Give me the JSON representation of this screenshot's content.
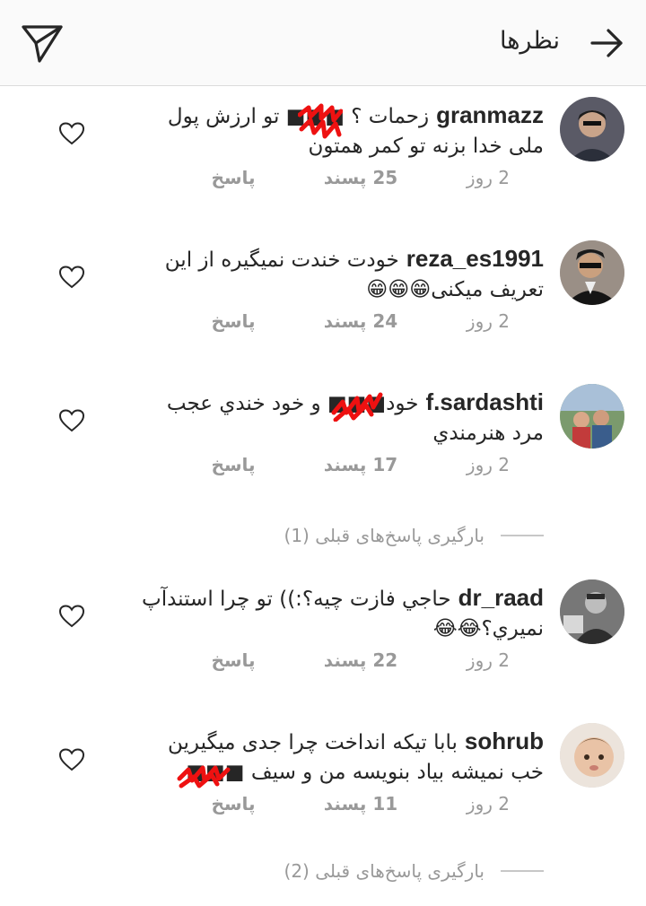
{
  "header": {
    "title": "نظرها",
    "back_icon": "arrow-right-icon",
    "send_icon": "paper-plane-icon"
  },
  "comments": [
    {
      "username": "granmazz",
      "text": "زحمات ؟ ■■■ تو ارزش پول ملی خدا بزنه تو کمر همتون",
      "time": "2 روز",
      "likes": "25 پسند",
      "reply": "پاسخ"
    },
    {
      "username": "reza_es1991",
      "text": "خودت خندت نمیگیره از این تعریف میکنی😁😁😁",
      "time": "2 روز",
      "likes": "24 پسند",
      "reply": "پاسخ"
    },
    {
      "username": "f.sardashti",
      "text": "خود■■■ و خود خندي عجب مرد هنرمندي",
      "time": "2 روز",
      "likes": "17 پسند",
      "reply": "پاسخ"
    },
    {
      "username": "dr_raad",
      "text": "حاجي فازت چيه؟:)) تو چرا استندآپ نميري؟😂😂",
      "time": "2 روز",
      "likes": "22 پسند",
      "reply": "پاسخ"
    },
    {
      "username": "sohrub",
      "text": "بابا تیکه انداخت چرا جدی میگیرین خب نمیشه بیاد بنویسه من و سیف ■■■",
      "time": "2 روز",
      "likes": "11 پسند",
      "reply": "پاسخ"
    }
  ],
  "load_previous": [
    {
      "label": "بارگیری پاسخ‌های قبلی (1)"
    },
    {
      "label": "بارگیری پاسخ‌های قبلی (2)"
    }
  ],
  "colors": {
    "header_bg": "#fafafa",
    "text": "#262626",
    "meta": "#999999",
    "censor_scribble": "#ee1111"
  }
}
